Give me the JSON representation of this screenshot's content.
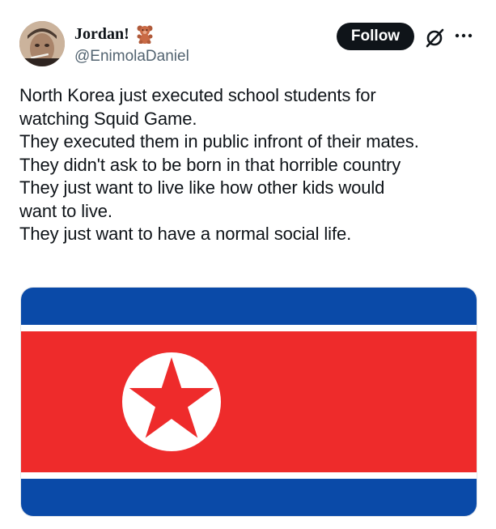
{
  "author": {
    "display_name": "Jordan!",
    "handle": "@EnimolaDaniel",
    "name_emoji": "teddy-bear-emoji",
    "avatar": "profile-photo"
  },
  "actions": {
    "follow_label": "Follow",
    "grok_icon": "grok-icon",
    "more_icon": "more-horizontal-icon"
  },
  "tweet": {
    "lines": [
      "North Korea just executed school students for",
      "watching Squid Game.",
      "They executed them in public infront of their mates.",
      "They didn't ask to be born in that horrible country",
      "They just want to live like how other kids would",
      "want to live.",
      "They just want to have a normal social life."
    ]
  },
  "media": {
    "type": "flag-image",
    "colors": {
      "blue": "#0a4aa8",
      "white": "#ffffff",
      "red": "#ee2b2b"
    }
  }
}
